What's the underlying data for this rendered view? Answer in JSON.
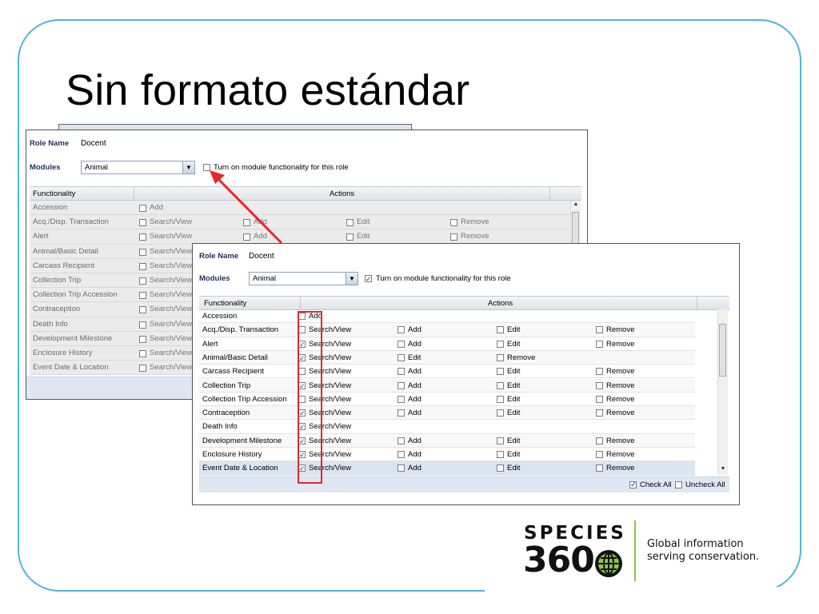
{
  "slide": {
    "title": "Sin formato estándar"
  },
  "back_panel": {
    "role_label": "Role Name",
    "role_value": "Docent",
    "modules_label": "Modules",
    "modules_value": "Animal",
    "module_toggle_label": "Turn on module functionality for this role",
    "module_toggle_checked": false,
    "columns": {
      "functionality": "Functionality",
      "actions": "Actions"
    },
    "rows": [
      {
        "name": "Accession",
        "actions": [
          {
            "label": "Add",
            "checked": false
          }
        ]
      },
      {
        "name": "Acq./Disp. Transaction",
        "actions": [
          {
            "label": "Search/View",
            "checked": false
          },
          {
            "label": "Add",
            "checked": false
          },
          {
            "label": "Edit",
            "checked": false
          },
          {
            "label": "Remove",
            "checked": false
          }
        ]
      },
      {
        "name": "Alert",
        "actions": [
          {
            "label": "Search/View",
            "checked": false
          },
          {
            "label": "Add",
            "checked": false
          },
          {
            "label": "Edit",
            "checked": false
          },
          {
            "label": "Remove",
            "checked": false
          }
        ]
      },
      {
        "name": "Animal/Basic Detail",
        "actions": [
          {
            "label": "Search/View",
            "checked": false
          }
        ]
      },
      {
        "name": "Carcass Recipient",
        "actions": [
          {
            "label": "Search/View",
            "checked": false
          }
        ]
      },
      {
        "name": "Collection Trip",
        "actions": [
          {
            "label": "Search/View",
            "checked": false
          }
        ]
      },
      {
        "name": "Collection Trip Accession",
        "actions": [
          {
            "label": "Search/View",
            "checked": false
          }
        ]
      },
      {
        "name": "Contraception",
        "actions": [
          {
            "label": "Search/View",
            "checked": false
          }
        ]
      },
      {
        "name": "Death Info",
        "actions": [
          {
            "label": "Search/View",
            "checked": false
          }
        ]
      },
      {
        "name": "Development Milestone",
        "actions": [
          {
            "label": "Search/View",
            "checked": false
          }
        ]
      },
      {
        "name": "Enclosure History",
        "actions": [
          {
            "label": "Search/View",
            "checked": false
          }
        ]
      },
      {
        "name": "Event Date & Location",
        "actions": [
          {
            "label": "Search/View",
            "checked": false
          }
        ]
      }
    ]
  },
  "front_panel": {
    "role_label": "Role Name",
    "role_value": "Docent",
    "modules_label": "Modules",
    "modules_value": "Animal",
    "module_toggle_label": "Turn on module functionality for this role",
    "module_toggle_checked": true,
    "columns": {
      "functionality": "Functionality",
      "actions": "Actions"
    },
    "rows": [
      {
        "name": "Accession",
        "actions": [
          {
            "label": "Add",
            "checked": false
          }
        ]
      },
      {
        "name": "Acq./Disp. Transaction",
        "actions": [
          {
            "label": "Search/View",
            "checked": false
          },
          {
            "label": "Add",
            "checked": false
          },
          {
            "label": "Edit",
            "checked": false
          },
          {
            "label": "Remove",
            "checked": false
          }
        ]
      },
      {
        "name": "Alert",
        "actions": [
          {
            "label": "Search/View",
            "checked": true
          },
          {
            "label": "Add",
            "checked": false
          },
          {
            "label": "Edit",
            "checked": false
          },
          {
            "label": "Remove",
            "checked": false
          }
        ]
      },
      {
        "name": "Animal/Basic Detail",
        "actions": [
          {
            "label": "Search/View",
            "checked": true
          },
          {
            "label": "Edit",
            "checked": false
          },
          {
            "label": "Remove",
            "checked": false
          }
        ]
      },
      {
        "name": "Carcass Recipient",
        "actions": [
          {
            "label": "Search/View",
            "checked": false
          },
          {
            "label": "Add",
            "checked": false
          },
          {
            "label": "Edit",
            "checked": false
          },
          {
            "label": "Remove",
            "checked": false
          }
        ]
      },
      {
        "name": "Collection Trip",
        "actions": [
          {
            "label": "Search/View",
            "checked": true
          },
          {
            "label": "Add",
            "checked": false
          },
          {
            "label": "Edit",
            "checked": false
          },
          {
            "label": "Remove",
            "checked": false
          }
        ]
      },
      {
        "name": "Collection Trip Accession",
        "actions": [
          {
            "label": "Search/View",
            "checked": false
          },
          {
            "label": "Add",
            "checked": false
          },
          {
            "label": "Edit",
            "checked": false
          },
          {
            "label": "Remove",
            "checked": false
          }
        ]
      },
      {
        "name": "Contraception",
        "actions": [
          {
            "label": "Search/View",
            "checked": true
          },
          {
            "label": "Add",
            "checked": false
          },
          {
            "label": "Edit",
            "checked": false
          },
          {
            "label": "Remove",
            "checked": false
          }
        ]
      },
      {
        "name": "Death Info",
        "actions": [
          {
            "label": "Search/View",
            "checked": true
          }
        ]
      },
      {
        "name": "Development Milestone",
        "actions": [
          {
            "label": "Search/View",
            "checked": true
          },
          {
            "label": "Add",
            "checked": false
          },
          {
            "label": "Edit",
            "checked": false
          },
          {
            "label": "Remove",
            "checked": false
          }
        ]
      },
      {
        "name": "Enclosure History",
        "actions": [
          {
            "label": "Search/View",
            "checked": true
          },
          {
            "label": "Add",
            "checked": false
          },
          {
            "label": "Edit",
            "checked": false
          },
          {
            "label": "Remove",
            "checked": false
          }
        ]
      },
      {
        "name": "Event Date & Location",
        "actions": [
          {
            "label": "Search/View",
            "checked": true
          },
          {
            "label": "Add",
            "checked": false
          },
          {
            "label": "Edit",
            "checked": false
          },
          {
            "label": "Remove",
            "checked": false
          }
        ]
      }
    ],
    "footer": {
      "check_all": "Check All",
      "check_all_checked": true,
      "uncheck_all": "Uncheck All",
      "uncheck_all_checked": false
    }
  },
  "logo": {
    "line1": "SPECIES",
    "line2": "360",
    "tagline_1": "Global information",
    "tagline_2": "serving conservation."
  },
  "colors": {
    "frame": "#4bb8d8",
    "highlight": "#e8262a",
    "logo_accent": "#8dc63f"
  }
}
